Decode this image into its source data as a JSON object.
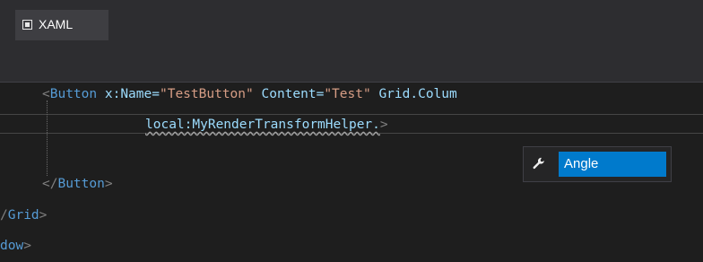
{
  "tab": {
    "label": "XAML",
    "icon": "xaml-document-icon"
  },
  "code": {
    "line1": {
      "open": "<",
      "tag": "Button",
      "attr1_name": "x:Name",
      "attr1_eq": "=",
      "attr1_value": "\"TestButton\"",
      "attr2_name": "Content",
      "attr2_eq": "=",
      "attr2_value": "\"Test\"",
      "attr3_name": "Grid.Colum"
    },
    "line2": {
      "typed": "local:MyRenderTransformHelper.",
      "close": ">"
    },
    "line3": {
      "open": "</",
      "tag": "Button",
      "close": ">"
    },
    "line4": {
      "open": "/",
      "tag": "Grid",
      "close": ">"
    },
    "line5": {
      "tag": "dow",
      "close": ">"
    }
  },
  "completion": {
    "icon": "wrench-property-icon",
    "selected_item": "Angle"
  },
  "colors": {
    "background": "#1e1e1e",
    "tag": "#569cd6",
    "attribute": "#9cdcfe",
    "string": "#d69d85",
    "selection": "#007acc"
  }
}
